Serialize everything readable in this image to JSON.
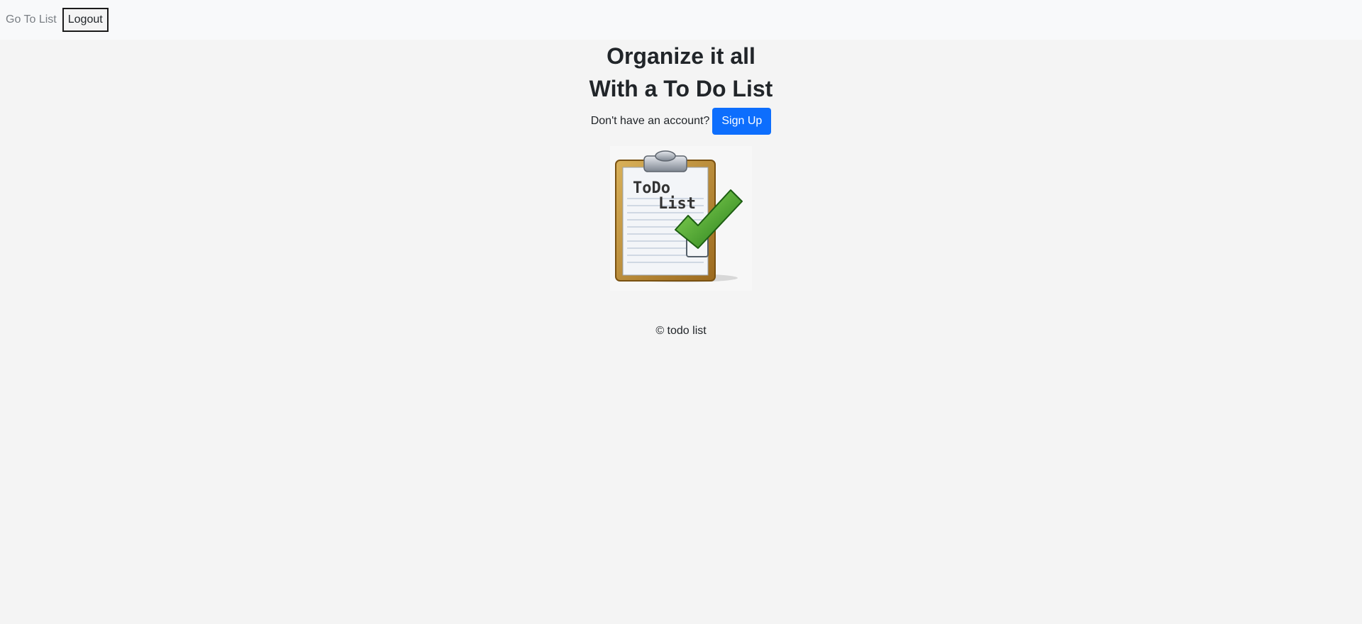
{
  "nav": {
    "go_to_list_label": "Go To List",
    "logout_label": "Logout"
  },
  "hero": {
    "headline_line1": "Organize it all",
    "headline_line2": "With a To Do List",
    "signup_prompt": "Don't have an account?",
    "signup_button": "Sign Up"
  },
  "logo": {
    "line1": "ToDo",
    "line2": "List",
    "icon": "clipboard-checkmark-icon"
  },
  "footer": {
    "text": "© todo list"
  },
  "colors": {
    "accent": "#0d6efd",
    "background": "#f4f4f4",
    "navbar": "#f8f9fa",
    "checkmark": "#3a9d2a"
  }
}
